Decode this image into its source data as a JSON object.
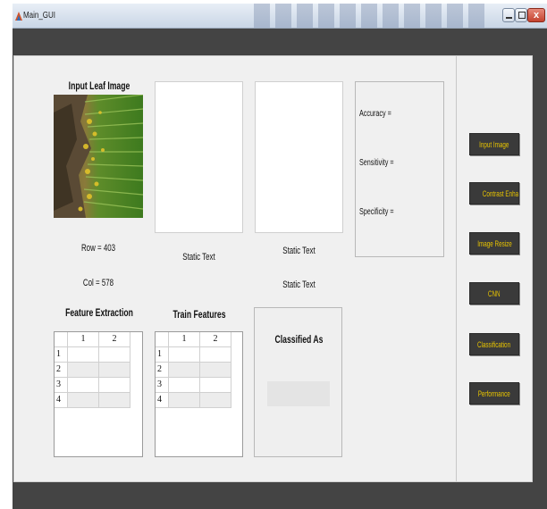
{
  "window": {
    "title": "Main_GUI",
    "close_glyph": "x"
  },
  "panel": {
    "input_leaf_title": "Input Leaf Image",
    "row_label": "Row = 403",
    "col_label": "Col = 578",
    "static_text_1": "Static Text",
    "static_text_2": "Static Text",
    "static_text_3": "Static Text",
    "feature_extraction_title": "Feature Extraction",
    "train_features_title": "Train Features",
    "classified_as_title": "Classified As"
  },
  "metrics": {
    "accuracy": "Accuracy =",
    "sensitivity": "Sensitivity =",
    "specificity": "Specificity ="
  },
  "buttons": [
    {
      "id": "input-image",
      "label": "Input Image"
    },
    {
      "id": "contrast-enhancement",
      "label": "Contrast Enhancement"
    },
    {
      "id": "image-resize",
      "label": "Image Resize"
    },
    {
      "id": "cnn",
      "label": "CNN"
    },
    {
      "id": "classification",
      "label": "Classification"
    },
    {
      "id": "performance",
      "label": "Performance"
    }
  ],
  "tables": {
    "feature_extraction": {
      "columns": [
        "1",
        "2"
      ],
      "rows": [
        "1",
        "2",
        "3",
        "4"
      ]
    },
    "train_features": {
      "columns": [
        "1",
        "2"
      ],
      "rows": [
        "1",
        "2",
        "3",
        "4"
      ]
    }
  },
  "colors": {
    "button_text": "#e8c400",
    "button_bg": "#3a3a3a",
    "figure_bg": "#f0f0f0"
  }
}
